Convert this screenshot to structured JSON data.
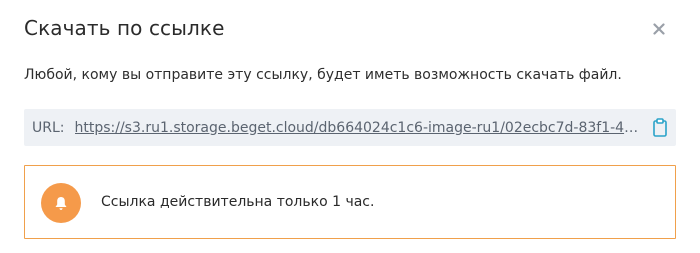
{
  "dialog": {
    "title": "Скачать по ссылке",
    "description": "Любой, кому вы отправите эту ссылку, будет иметь возможность скачать файл.",
    "url": {
      "label": "URL:",
      "value": "https://s3.ru1.storage.beget.cloud/db664024c1c6-image-ru1/02ecbc7d-83f1-453a..."
    },
    "notice": {
      "text": "Ссылка действительна только 1 час."
    }
  },
  "colors": {
    "accent_orange": "#f59a4a",
    "notice_border": "#f0a04b",
    "copy_icon": "#2aa3c9",
    "url_background": "#eef1f5"
  },
  "icons": {
    "close": "close-icon",
    "copy": "clipboard-icon",
    "notice": "bell-icon"
  }
}
